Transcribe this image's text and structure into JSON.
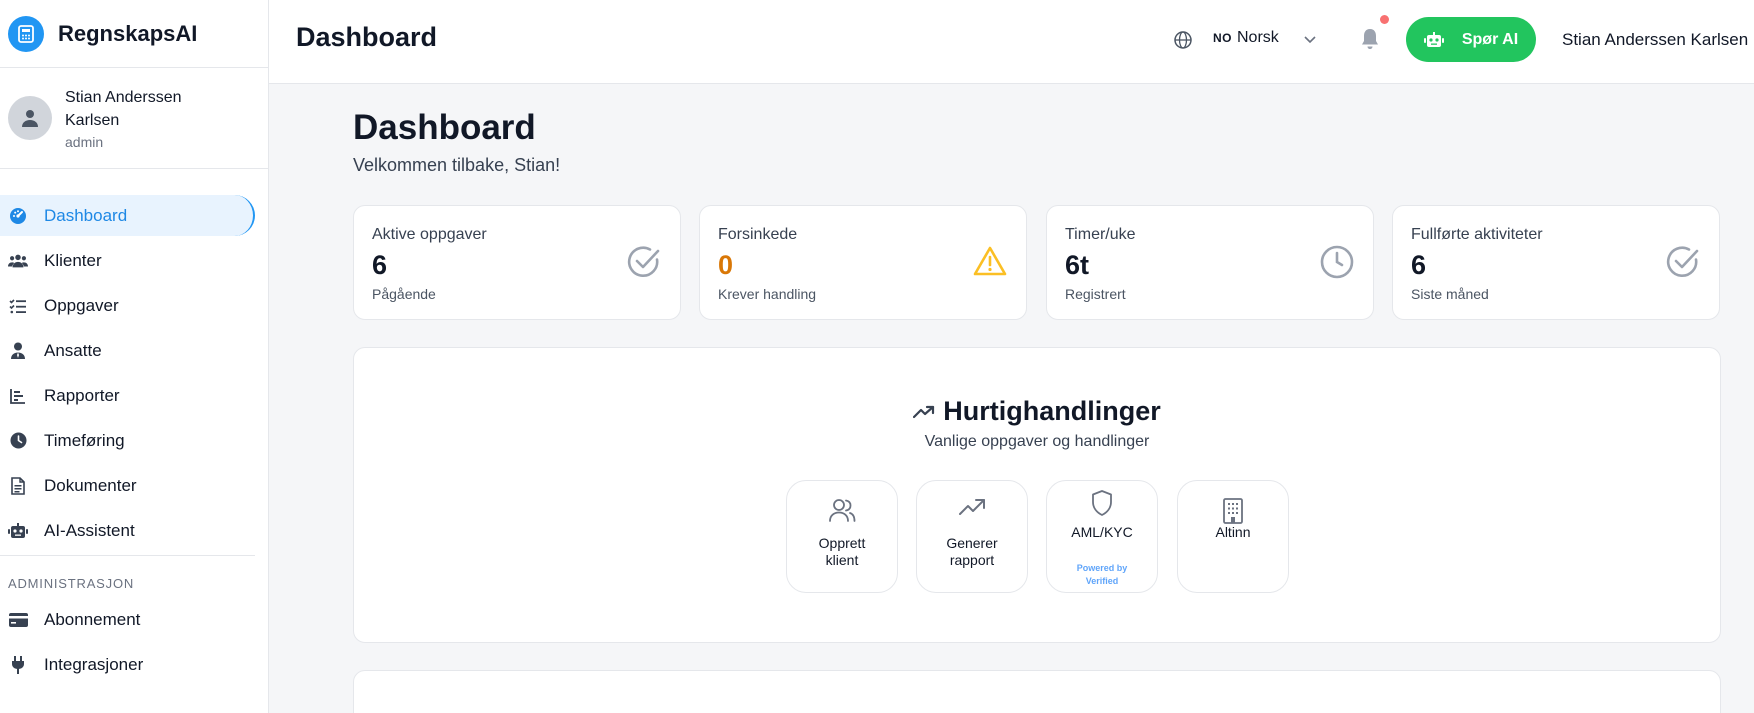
{
  "app": {
    "name": "RegnskapsAI",
    "logo_icon": "calculator-icon",
    "accent": "#2196f3"
  },
  "sidebar": {
    "user": {
      "name": "Stian Anderssen Karlsen",
      "role": "admin"
    },
    "items": [
      {
        "label": "Dashboard",
        "icon": "gauge-icon",
        "active": true
      },
      {
        "label": "Klienter",
        "icon": "users-icon"
      },
      {
        "label": "Oppgaver",
        "icon": "tasks-icon"
      },
      {
        "label": "Ansatte",
        "icon": "employee-icon"
      },
      {
        "label": "Rapporter",
        "icon": "bar-chart-icon"
      },
      {
        "label": "Timeføring",
        "icon": "clock-icon"
      },
      {
        "label": "Dokumenter",
        "icon": "document-icon"
      },
      {
        "label": "AI-Assistent",
        "icon": "robot-icon"
      }
    ],
    "admin_section": "ADMINISTRASJON",
    "admin_items": [
      {
        "label": "Abonnement",
        "icon": "credit-card-icon"
      },
      {
        "label": "Integrasjoner",
        "icon": "plug-icon"
      }
    ]
  },
  "header": {
    "title": "Dashboard",
    "language": {
      "code": "NO",
      "label": "Norsk"
    },
    "ask_ai": "Spør AI",
    "user_name": "Stian Anderssen Karlsen",
    "ask_ai_color": "#22c55e",
    "notification_dot_color": "#f87171"
  },
  "main": {
    "title": "Dashboard",
    "subtitle": "Velkommen tilbake, Stian!",
    "stats": [
      {
        "label": "Aktive oppgaver",
        "value": "6",
        "sub": "Pågående",
        "icon": "check-circle-icon"
      },
      {
        "label": "Forsinkede",
        "value": "0",
        "sub": "Krever handling",
        "icon": "warning-icon",
        "value_color": "#d97706"
      },
      {
        "label": "Timer/uke",
        "value": "6t",
        "sub": "Registrert",
        "icon": "clock-icon"
      },
      {
        "label": "Fullførte aktiviteter",
        "value": "6",
        "sub": "Siste måned",
        "icon": "check-circle-icon"
      }
    ],
    "quick_actions": {
      "title": "Hurtighandlinger",
      "subtitle": "Vanlige oppgaver og handlinger",
      "items": [
        {
          "label": "Opprett klient",
          "line1": "Opprett",
          "line2": "klient",
          "icon": "users-icon"
        },
        {
          "label": "Generer rapport",
          "line1": "Generer",
          "line2": "rapport",
          "icon": "trending-up-icon"
        },
        {
          "label": "AML/KYC",
          "icon": "shield-icon",
          "powered_line1": "Powered by",
          "powered_line2": "Verified"
        },
        {
          "label": "Altinn",
          "icon": "building-icon"
        }
      ]
    }
  }
}
